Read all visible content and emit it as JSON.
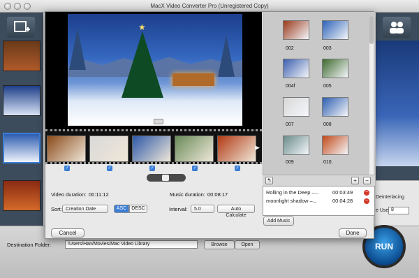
{
  "window": {
    "title": "MacX Video Converter Pro (Unregistered Copy)"
  },
  "background": {
    "destination_label": "Destination Folder:",
    "destination_path": "/Users/Han/Movies/Mac Video Library",
    "browse_label": "Browse",
    "open_label": "Open",
    "run_label": "RUN",
    "deinterlacing_label": "Deinterlacing",
    "core_use_label": "e Use:",
    "core_use_value": "8"
  },
  "slideshow": {
    "video_duration_label": "Video duration:",
    "video_duration": "00:11:12",
    "music_duration_label": "Music duration:",
    "music_duration": "00:08:17",
    "sort_label": "Sort:",
    "sort_value": "Creation Date",
    "asc_label": "ASC",
    "desc_label": "DESC",
    "interval_label": "Interval:",
    "interval_value": "5.0",
    "auto_calculate_label": "Auto Calculate",
    "cancel_label": "Cancel",
    "done_label": "Done",
    "add_music_label": "Add Music"
  },
  "image_grid": [
    {
      "label": "002",
      "color": "#9a3a1c"
    },
    {
      "label": "003",
      "color": "#2e63b8"
    },
    {
      "label": "004f",
      "color": "#3c5fae"
    },
    {
      "label": "005",
      "color": "#3e6a2e"
    },
    {
      "label": "007",
      "color": "#d8d8d8"
    },
    {
      "label": "008",
      "color": "#2d5db0"
    },
    {
      "label": "009",
      "color": "#6a8c8a"
    },
    {
      "label": "010.",
      "color": "#c24a1a"
    }
  ],
  "film_frames": [
    {
      "color": "#8a4a1a"
    },
    {
      "color": "#d9d9d9"
    },
    {
      "color": "#2d58a8"
    },
    {
      "color": "#6a8c5a"
    },
    {
      "color": "#b23a14"
    }
  ],
  "music_list": [
    {
      "title": "Rolling in the Deep –...",
      "duration": "00:03:49"
    },
    {
      "title": "moonlight shadow –...",
      "duration": "00:04:28"
    }
  ]
}
